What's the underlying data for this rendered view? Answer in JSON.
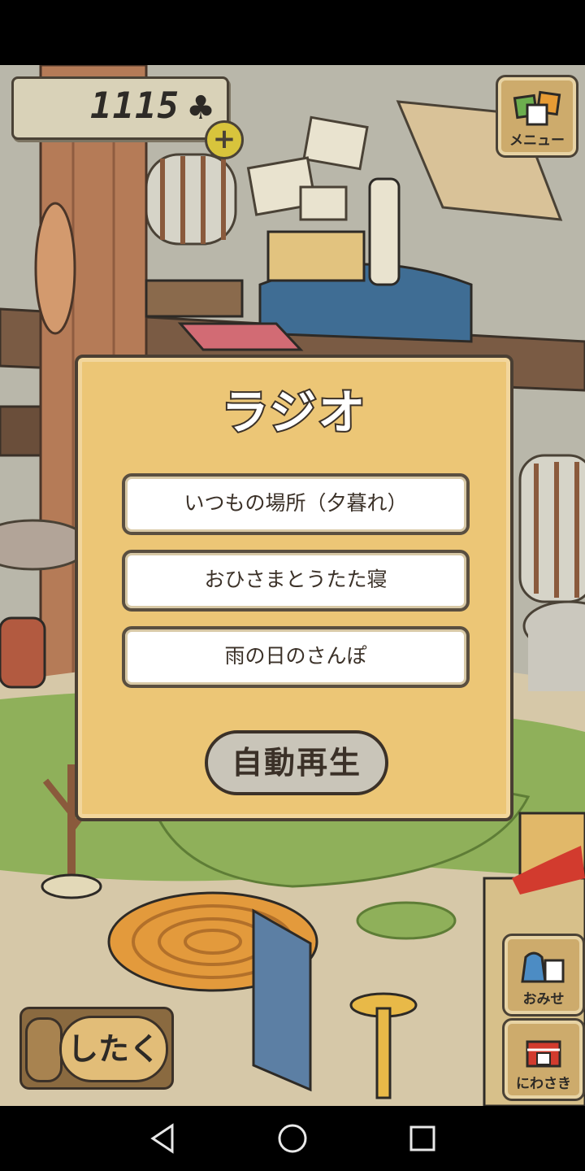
{
  "currency": {
    "count": "1115",
    "symbol": "♣",
    "add_label": "+"
  },
  "menu_button": {
    "label": "メニュー"
  },
  "omise_button": {
    "label": "おみせ"
  },
  "niwasaki_button": {
    "label": "にわさき"
  },
  "shitaku_button": {
    "label": "したく"
  },
  "radio_dialog": {
    "title": "ラジオ",
    "stations": [
      {
        "label": "いつもの場所（夕暮れ）"
      },
      {
        "label": "おひさまとうたた寝"
      },
      {
        "label": "雨の日のさんぽ"
      }
    ],
    "autoplay_label": "自動再生"
  },
  "nav": {
    "back_icon": "back-triangle-icon",
    "home_icon": "home-circle-icon",
    "recents_icon": "recents-square-icon"
  },
  "colors": {
    "modal_bg": "#ecc676",
    "grass": "#8fb05a",
    "wall": "#b9b7aa"
  }
}
